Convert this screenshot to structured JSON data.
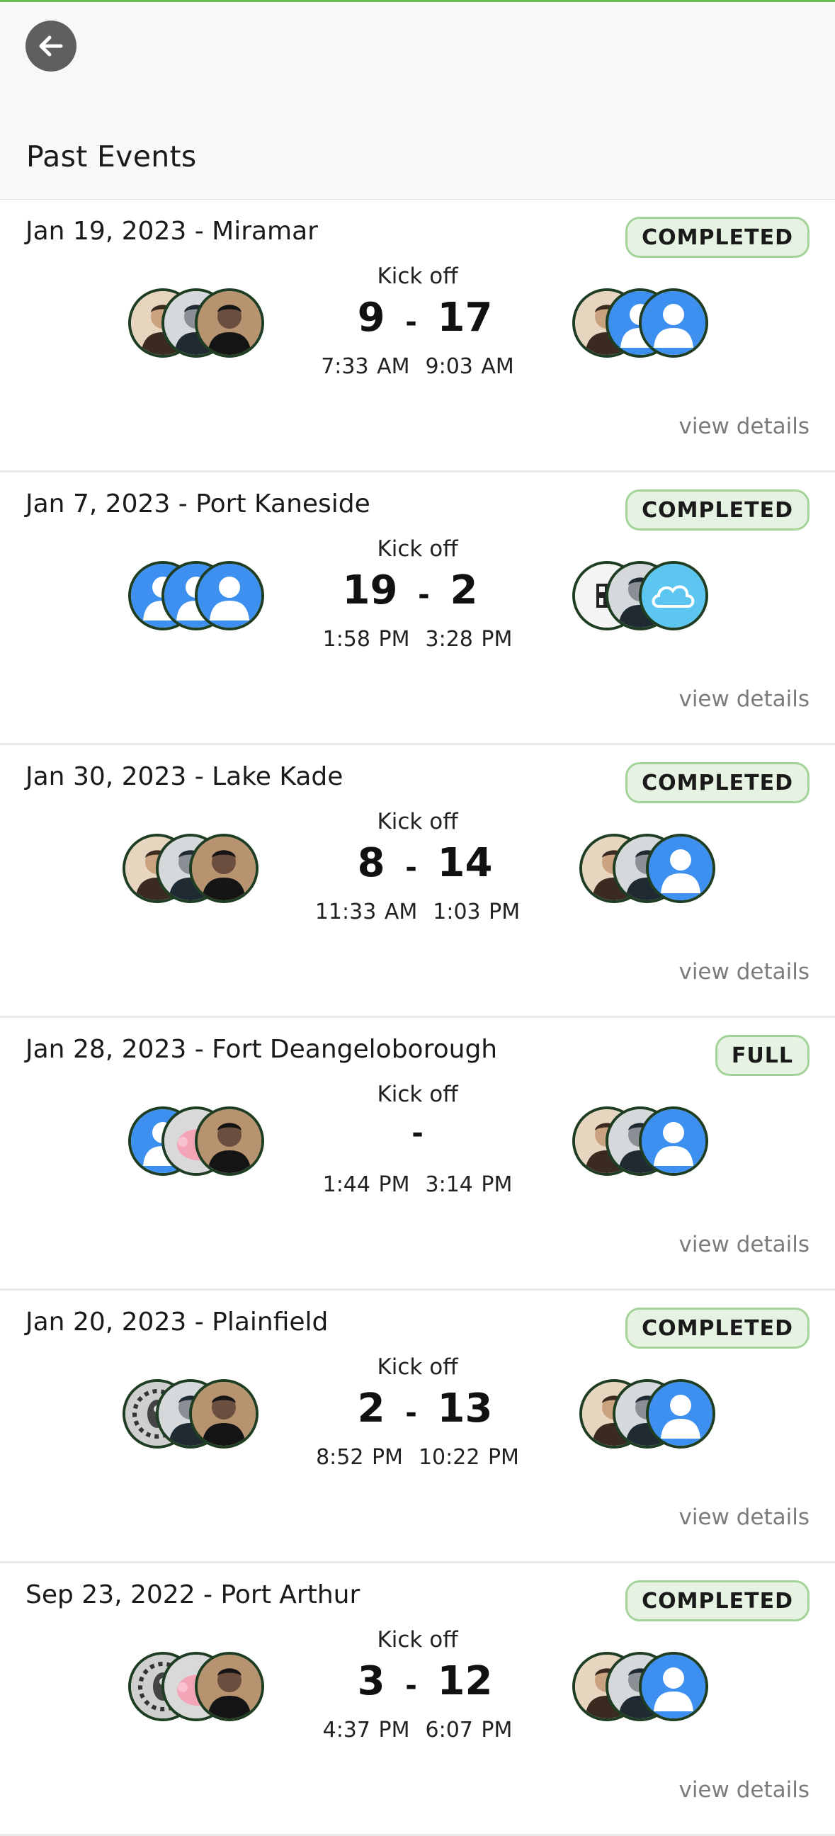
{
  "header": {
    "title": "Past Events"
  },
  "labels": {
    "kickoff": "Kick off",
    "view_details": "view details",
    "score_separator": "-"
  },
  "colors": {
    "accent": "#6bbf59",
    "badge_bg": "#e6f2e2",
    "badge_border": "#a4d39a",
    "avatar_ring": "#1e3d22",
    "default_avatar": "#3d8ff0"
  },
  "events": [
    {
      "title": "Jan 19, 2023 - Miramar",
      "status": "COMPLETED",
      "home_score": "9",
      "away_score": "17",
      "start": "7:33 AM",
      "end": "9:03 AM",
      "home_players": [
        "photo",
        "photo",
        "photo"
      ],
      "away_players": [
        "photo",
        "default",
        "default"
      ]
    },
    {
      "title": "Jan 7, 2023 - Port Kaneside",
      "status": "COMPLETED",
      "home_score": "19",
      "away_score": "2",
      "start": "1:58 PM",
      "end": "3:28 PM",
      "home_players": [
        "default",
        "default",
        "default"
      ],
      "away_players": [
        "qr",
        "photo",
        "cloud"
      ]
    },
    {
      "title": "Jan 30, 2023 - Lake Kade",
      "status": "COMPLETED",
      "home_score": "8",
      "away_score": "14",
      "start": "11:33 AM",
      "end": "1:03 PM",
      "home_players": [
        "photo",
        "photo",
        "photo"
      ],
      "away_players": [
        "photo",
        "photo",
        "default"
      ]
    },
    {
      "title": "Jan 28, 2023 - Fort Deangeloborough",
      "status": "FULL",
      "home_score": "",
      "away_score": "",
      "start": "1:44 PM",
      "end": "3:14 PM",
      "home_players": [
        "default",
        "pig",
        "photo"
      ],
      "away_players": [
        "photo",
        "photo",
        "default"
      ]
    },
    {
      "title": "Jan 20, 2023 - Plainfield",
      "status": "COMPLETED",
      "home_score": "2",
      "away_score": "13",
      "start": "8:52 PM",
      "end": "10:22 PM",
      "home_players": [
        "robot",
        "photo",
        "photo"
      ],
      "away_players": [
        "photo",
        "photo",
        "default"
      ]
    },
    {
      "title": "Sep 23, 2022 - Port Arthur",
      "status": "COMPLETED",
      "home_score": "3",
      "away_score": "12",
      "start": "4:37 PM",
      "end": "6:07 PM",
      "home_players": [
        "robot",
        "pig",
        "photo"
      ],
      "away_players": [
        "photo",
        "photo",
        "default"
      ]
    }
  ]
}
